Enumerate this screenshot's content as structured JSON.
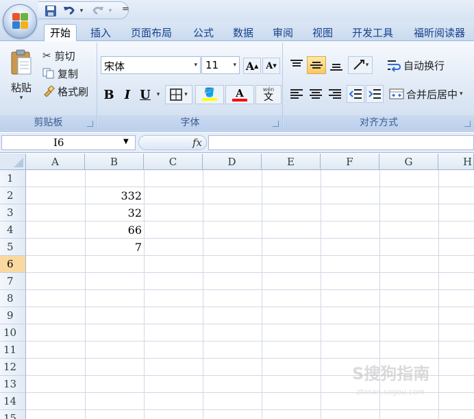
{
  "qat": {
    "more_label": "="
  },
  "tabs": [
    "开始",
    "插入",
    "页面布局",
    "公式",
    "数据",
    "审阅",
    "视图",
    "开发工具",
    "福昕阅读器"
  ],
  "clipboard": {
    "paste_label": "粘贴",
    "cut_label": "剪切",
    "copy_label": "复制",
    "format_painter_label": "格式刷",
    "group_label": "剪贴板"
  },
  "font": {
    "name": "宋体",
    "size": "11",
    "bold": "B",
    "italic": "I",
    "underline": "U",
    "grow": "A",
    "shrink": "A",
    "font_color_letter": "A",
    "phonetic": "wén",
    "phonetic_char": "文",
    "group_label": "字体",
    "colors": {
      "highlight": "#ffff00",
      "font": "#ff0000"
    }
  },
  "alignment": {
    "wrap_text_label": "自动换行",
    "merge_center_label": "合并后居中",
    "group_label": "对齐方式"
  },
  "formula_bar": {
    "name_box": "I6",
    "fx": "fx",
    "formula": ""
  },
  "sheet": {
    "columns": [
      "A",
      "B",
      "C",
      "D",
      "E",
      "F",
      "G",
      "H"
    ],
    "rows": [
      "1",
      "2",
      "3",
      "4",
      "5",
      "6",
      "7",
      "8",
      "9",
      "10",
      "11",
      "12",
      "13",
      "14",
      "15"
    ],
    "active_row": "6",
    "cells": {
      "B2": "332",
      "B3": "32",
      "B4": "66",
      "B5": "7"
    }
  },
  "watermark": {
    "text": "S搜狗指南",
    "sub": "zhinan.sogou.com"
  }
}
